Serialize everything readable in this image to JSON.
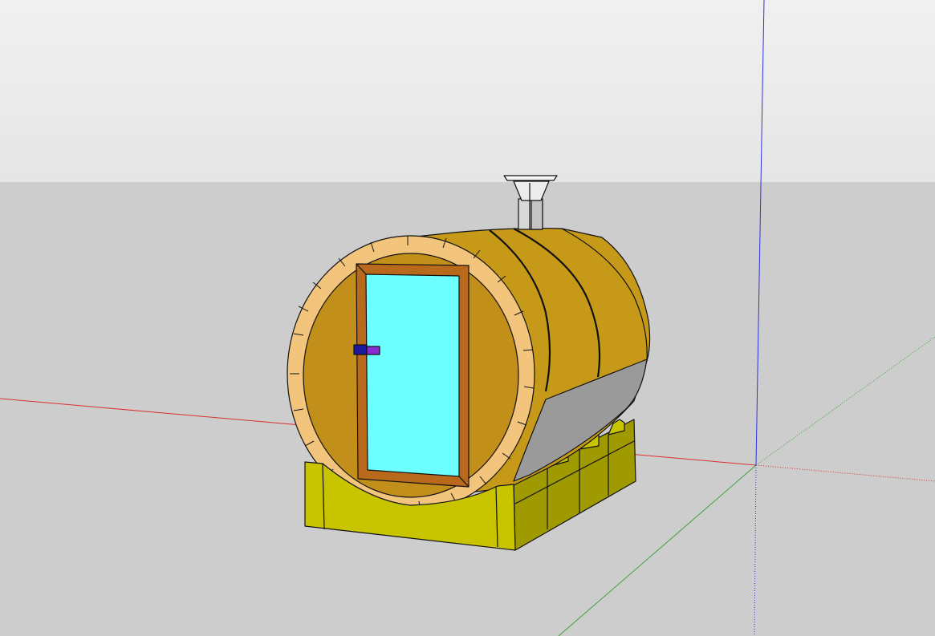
{
  "app": {
    "view": "3d-modeling-viewport",
    "model": "barrel-sauna"
  },
  "scene": {
    "sky_color": "#e6e6e6",
    "sky_top_color": "#f0f0f0",
    "ground_color": "#cdcdcd",
    "axes": {
      "red_axis_color": "#d93030",
      "green_axis_color": "#3aa23a",
      "blue_axis_color": "#3030e0"
    }
  },
  "model_colors": {
    "barrel_wood": "#c69a18",
    "barrel_wood_shadow": "#b38a10",
    "barrel_underside": "#9a9a9a",
    "front_ring": "#f2c47c",
    "front_panel": "#c2901a",
    "door_frame": "#b8691c",
    "door_glass": "#6dffff",
    "door_handle": "#1a1aa0",
    "door_handle_tip": "#8a2ad6",
    "chimney": "#d8d8d8",
    "base_front": "#c8c400",
    "base_side": "#9e9a00",
    "outline": "#111111"
  },
  "icons": {
    "axis_origin": "axes-origin-icon"
  }
}
